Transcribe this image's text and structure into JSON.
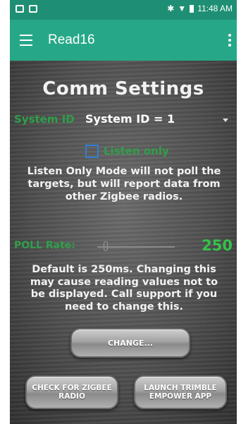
{
  "status_bar": {
    "time": "11:48 AM",
    "icons": [
      "image-icon",
      "cast-icon",
      "bluetooth-icon",
      "wifi-icon",
      "battery-icon"
    ]
  },
  "app_bar": {
    "title": "Read16",
    "menu_icon": "hamburger-menu-icon",
    "overflow_icon": "more-vert-icon"
  },
  "page": {
    "title": "Comm Settings",
    "system_id": {
      "label": "System ID",
      "selected": "System ID = 1"
    },
    "listen_only": {
      "label": "Listen only",
      "checked": false,
      "description": "Listen Only Mode will not poll the targets, but will report data from other Zigbee radios."
    },
    "poll_rate": {
      "label": "POLL Rate:",
      "value": "250",
      "slider_fraction": 0.05,
      "description": "Default is 250ms. Changing this may cause reading values not to be displayed. Call support if you need to change this."
    },
    "buttons": {
      "change": "CHANGE...",
      "check_zigbee": "CHECK FOR ZIGBEE RADIO",
      "launch_trimble": "LAUNCH TRIMBLE EMPOWER APP"
    }
  },
  "colors": {
    "status_bar": "#1e8f74",
    "app_bar": "#26a888",
    "label_green": "#2f9f49",
    "value_green": "#34c24a",
    "checkbox_blue": "#2f7fd4"
  }
}
